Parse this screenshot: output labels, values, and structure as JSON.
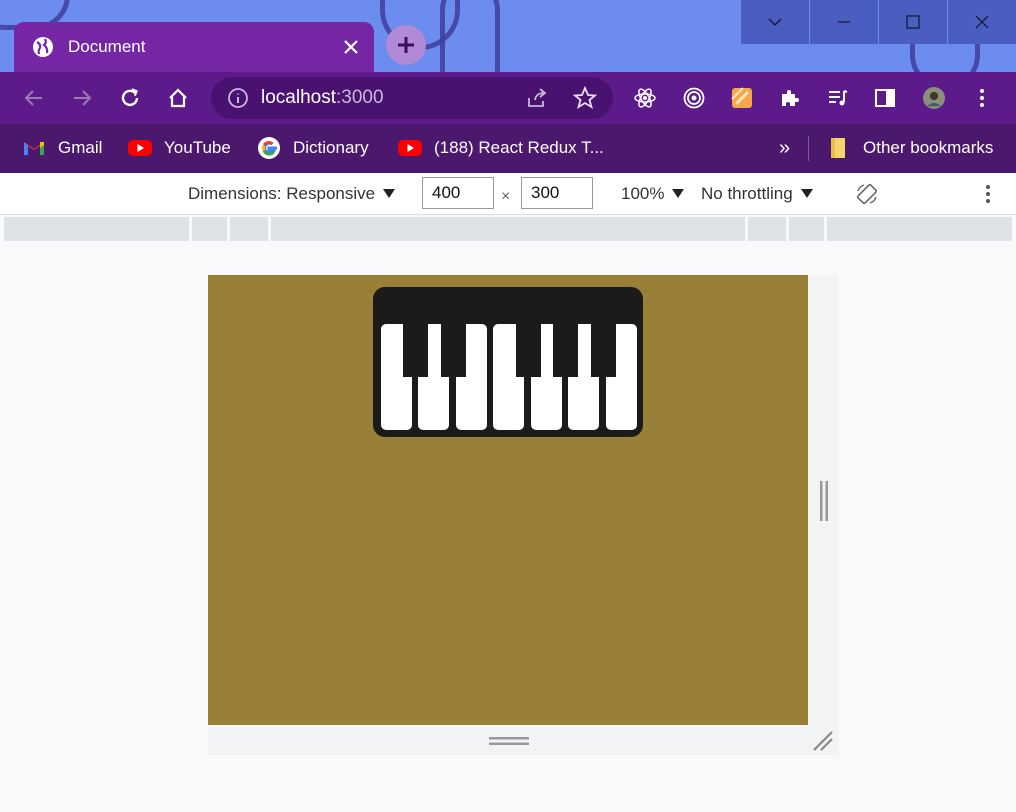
{
  "window": {
    "tab_title": "Document",
    "controls": [
      "chevron-down",
      "minimize",
      "maximize",
      "close"
    ]
  },
  "toolbar": {
    "url_host": "localhost",
    "url_port": ":3000"
  },
  "bookmarks": {
    "items": [
      {
        "label": "Gmail",
        "icon": "gmail-icon"
      },
      {
        "label": "YouTube",
        "icon": "youtube-icon"
      },
      {
        "label": "Dictionary",
        "icon": "google-icon"
      },
      {
        "label": "(188) React Redux T...",
        "icon": "youtube-icon"
      }
    ],
    "overflow": "»",
    "other": "Other bookmarks"
  },
  "devtools": {
    "dimensions_label": "Dimensions: Responsive",
    "width": "400",
    "times": "×",
    "height": "300",
    "zoom": "100%",
    "throttling": "No throttling"
  },
  "colors": {
    "page_background": "#998036",
    "keyboard": "#1b1b1b",
    "tab": "#7526a5",
    "toolbar": "#5d1a8a"
  },
  "keyboard": {
    "white_keys": 7,
    "black_keys": 5
  }
}
